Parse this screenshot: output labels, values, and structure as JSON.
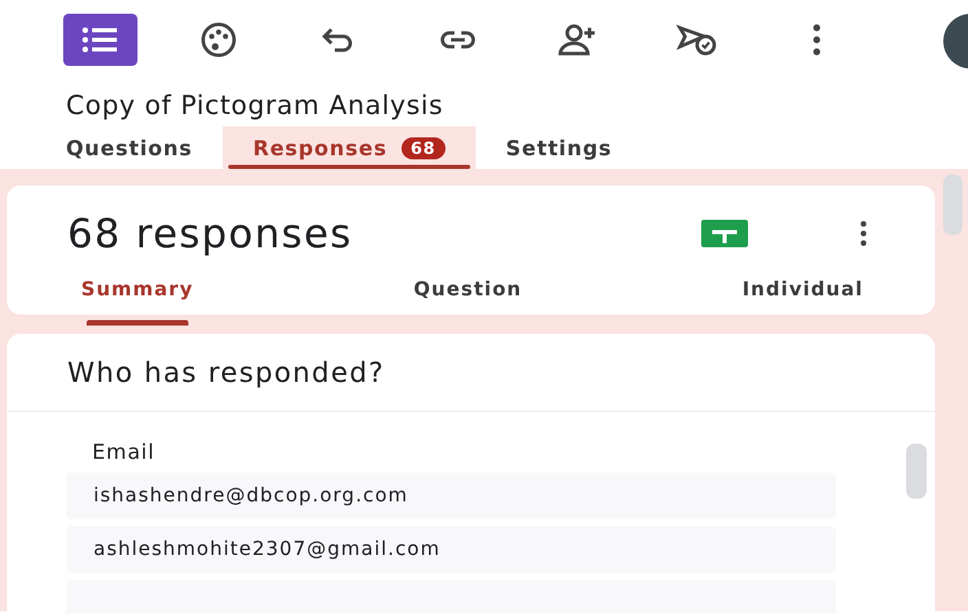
{
  "form": {
    "title": "Copy of Pictogram Analysis"
  },
  "tabs": [
    {
      "label": "Questions",
      "selected": false
    },
    {
      "label": "Responses",
      "selected": true,
      "badge": "68"
    },
    {
      "label": "Settings",
      "selected": false
    }
  ],
  "summary_card": {
    "heading": "68 responses",
    "subtabs": [
      {
        "label": "Summary",
        "selected": true
      },
      {
        "label": "Question",
        "selected": false
      },
      {
        "label": "Individual",
        "selected": false
      }
    ]
  },
  "respondents_card": {
    "heading": "Who has responded?",
    "column": "Email",
    "rows": [
      "ishashendre@dbcop.org.com",
      "ashleshmohite2307@gmail.com"
    ]
  }
}
